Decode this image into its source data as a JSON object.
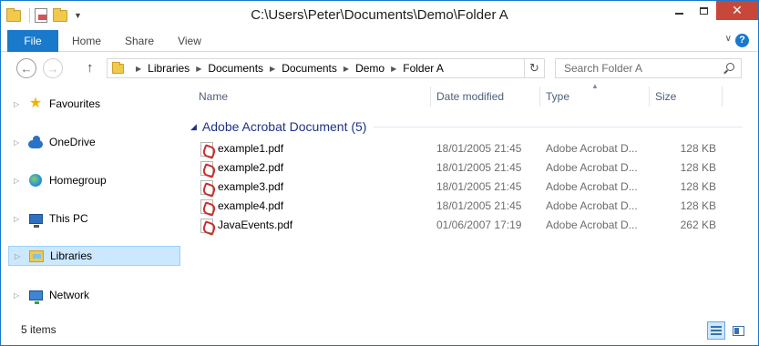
{
  "window": {
    "title": "C:\\Users\\Peter\\Documents\\Demo\\Folder A",
    "quick_access_icons": [
      "folder-icon",
      "properties-icon",
      "new-folder-icon"
    ],
    "controls": {
      "minimize": "",
      "maximize": "",
      "close": "✕"
    }
  },
  "ribbon": {
    "tabs": [
      "File",
      "Home",
      "Share",
      "View"
    ],
    "help": "?"
  },
  "address_bar": {
    "crumbs": [
      "Libraries",
      "Documents",
      "Documents",
      "Demo",
      "Folder A"
    ],
    "search_placeholder": "Search Folder A"
  },
  "nav_pane": {
    "items": [
      {
        "label": "Favourites",
        "icon": "star-icon",
        "selected": false
      },
      {
        "label": "OneDrive",
        "icon": "cloud-icon",
        "selected": false
      },
      {
        "label": "Homegroup",
        "icon": "homegroup-icon",
        "selected": false
      },
      {
        "label": "This PC",
        "icon": "computer-icon",
        "selected": false
      },
      {
        "label": "Libraries",
        "icon": "libraries-icon",
        "selected": true
      },
      {
        "label": "Network",
        "icon": "network-icon",
        "selected": false
      }
    ]
  },
  "file_list": {
    "columns": [
      "Name",
      "Date modified",
      "Type",
      "Size"
    ],
    "sorted_column": "Type",
    "group": {
      "title": "Adobe Acrobat Document (5)"
    },
    "files": [
      {
        "name": "example1.pdf",
        "date": "18/01/2005 21:45",
        "type": "Adobe Acrobat D...",
        "size": "128 KB"
      },
      {
        "name": "example2.pdf",
        "date": "18/01/2005 21:45",
        "type": "Adobe Acrobat D...",
        "size": "128 KB"
      },
      {
        "name": "example3.pdf",
        "date": "18/01/2005 21:45",
        "type": "Adobe Acrobat D...",
        "size": "128 KB"
      },
      {
        "name": "example4.pdf",
        "date": "18/01/2005 21:45",
        "type": "Adobe Acrobat D...",
        "size": "128 KB"
      },
      {
        "name": "JavaEvents.pdf",
        "date": "01/06/2007 17:19",
        "type": "Adobe Acrobat D...",
        "size": "262 KB"
      }
    ]
  },
  "status_bar": {
    "item_count": "5 items",
    "active_view": "details"
  },
  "colors": {
    "accent": "#1979ca",
    "close_button": "#c7473a",
    "group_header": "#1e3287",
    "selected_background": "#cce8ff"
  }
}
